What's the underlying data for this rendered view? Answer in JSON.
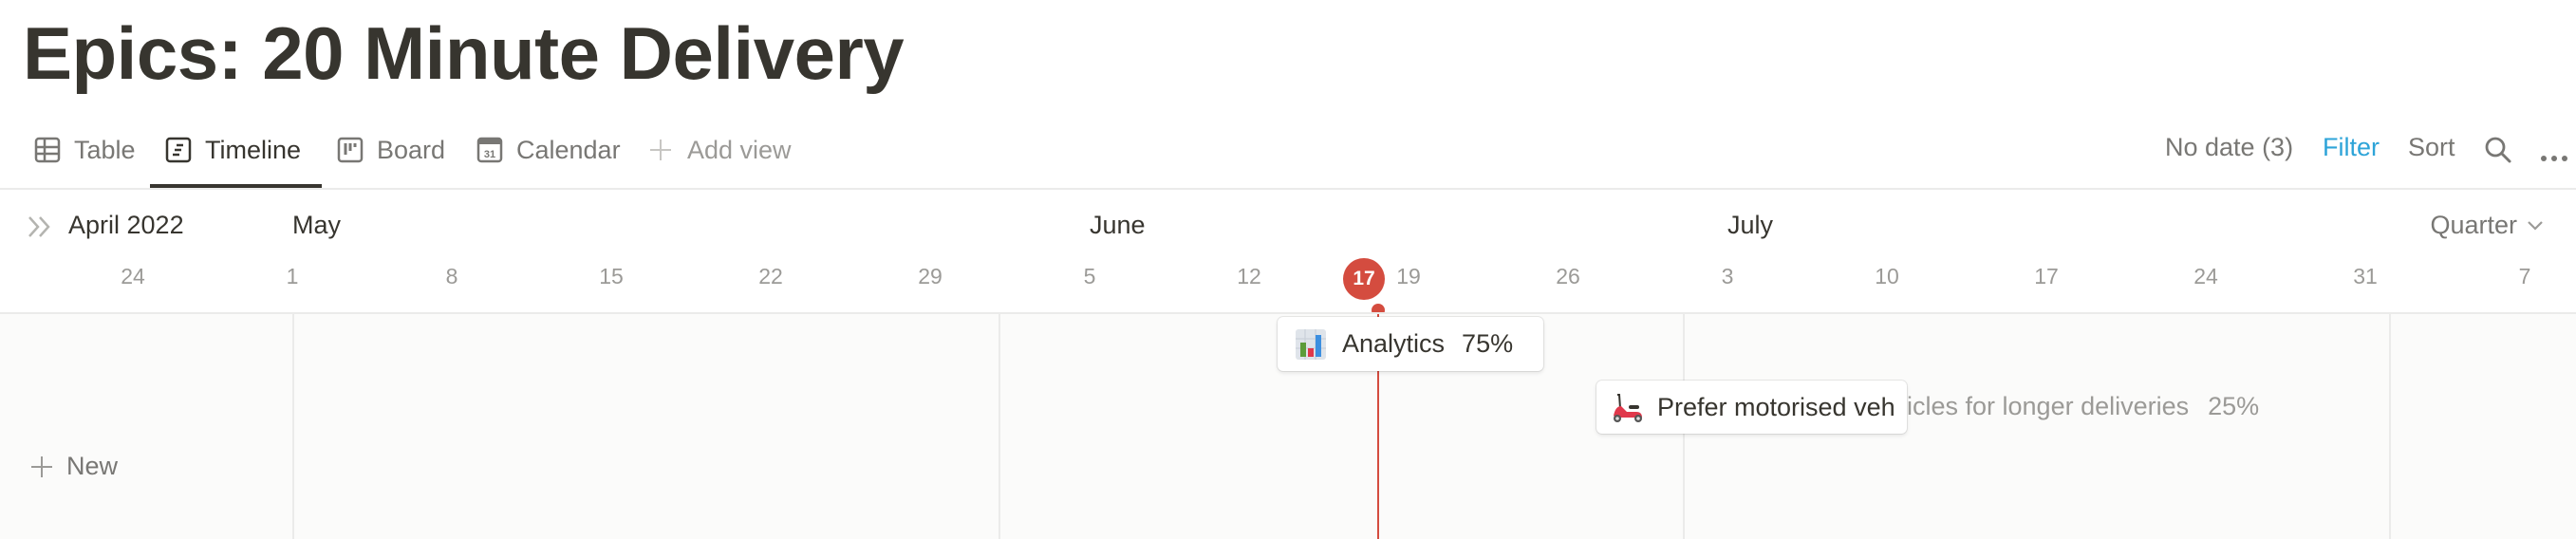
{
  "page": {
    "title": "Epics: 20 Minute Delivery"
  },
  "views": {
    "tabs": [
      {
        "label": "Table",
        "icon": "table-icon",
        "active": false
      },
      {
        "label": "Timeline",
        "icon": "timeline-icon",
        "active": true
      },
      {
        "label": "Board",
        "icon": "board-icon",
        "active": false
      },
      {
        "label": "Calendar",
        "icon": "calendar-icon",
        "active": false
      }
    ],
    "add_view_label": "Add view",
    "calendar_icon_day": "31"
  },
  "actions": {
    "no_date": "No date (3)",
    "filter": "Filter",
    "sort": "Sort",
    "filter_color": "#2ea4d8"
  },
  "timeline": {
    "current_month_label": "April 2022",
    "months": [
      "May",
      "June",
      "July"
    ],
    "zoom_select": "Quarter",
    "ticks": [
      "24",
      "1",
      "8",
      "15",
      "22",
      "29",
      "5",
      "12",
      "19",
      "26",
      "3",
      "10",
      "17",
      "24",
      "31",
      "7"
    ],
    "today": "17",
    "today_color": "#d44c3f",
    "new_label": "New"
  },
  "items": [
    {
      "icon": "bar-chart-emoji",
      "name": "Analytics",
      "progress": "75%"
    },
    {
      "icon": "motor-scooter-emoji",
      "name_visible": "Prefer motorised veh",
      "name_overflow": "icles for longer deliveries",
      "name": "Prefer motorised vehicles for longer deliveries",
      "progress": "25%"
    }
  ]
}
